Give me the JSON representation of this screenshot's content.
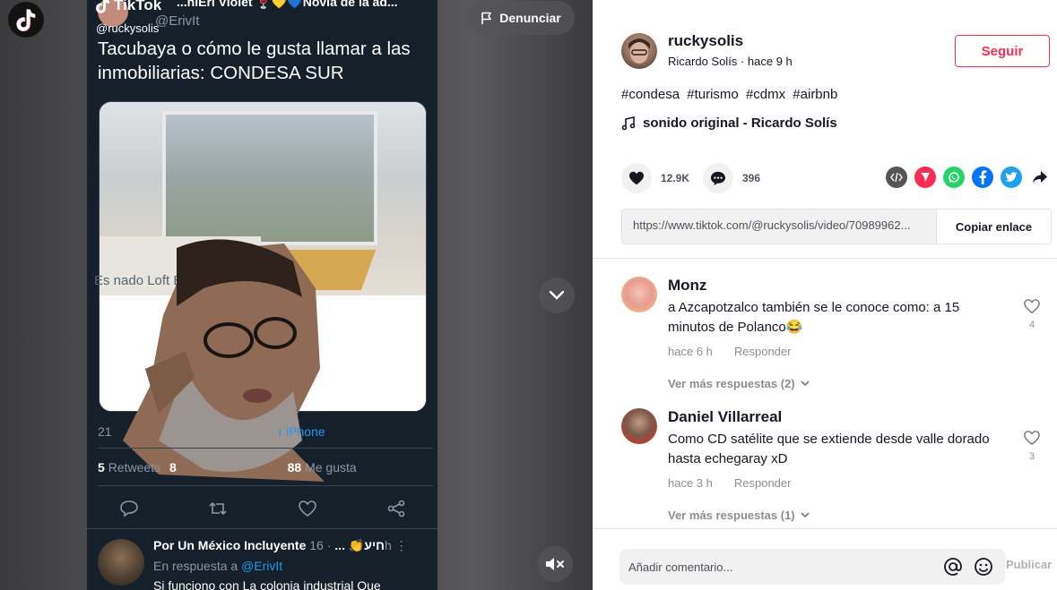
{
  "video": {
    "report_label": "Denunciar",
    "watermark_brand": "TikTok",
    "watermark_user": "@ruckysolis",
    "tweet": {
      "author_name": "...hiEri Violet 🍷💛💙Novia de la ad...",
      "author_handle": "@ErivIt",
      "text": "Tacubaya o cómo le gusta llamar a las inmobiliarias: CONDESA SUR",
      "card_caption": "Es          nado Loft En Condesa Su                566",
      "meta_prefix": "21",
      "meta_source": "r iPhone",
      "retweets_count": "5",
      "retweets_label": "Retweets",
      "quotes_count": "8",
      "likes_count": "88",
      "likes_label": "Me gusta"
    },
    "reply": {
      "author_name": "Por Un México Incluyente חיע👏 ...",
      "time": "· 16h",
      "in_reply_prefix": "En respuesta a",
      "in_reply_handle": "@ErivIt",
      "text": "Si funciono con La colonia industrial Que"
    }
  },
  "author": {
    "username": "ruckysolis",
    "display_name": "Ricardo Solís",
    "time_ago": "hace 9 h",
    "follow_label": "Seguir"
  },
  "description": {
    "hashtags": [
      "#condesa",
      "#turismo",
      "#cdmx",
      "#airbnb"
    ],
    "music": "sonido original - Ricardo Solís"
  },
  "stats": {
    "likes": "12.9K",
    "comments": "396"
  },
  "share": {
    "icons": [
      "embed-icon",
      "send-icon",
      "whatsapp-icon",
      "facebook-icon",
      "twitter-icon",
      "share-arrow-icon"
    ]
  },
  "link": {
    "url": "https://www.tiktok.com/@ruckysolis/video/70989962...",
    "copy_label": "Copiar enlace"
  },
  "comments": [
    {
      "name": "Monz",
      "text": "a Azcapotzalco también se le conoce como: a 15 minutos de Polanco😂",
      "time": "hace 6 h",
      "reply_label": "Responder",
      "likes": "4",
      "more_replies": "Ver más respuestas (2)"
    },
    {
      "name": "Daniel Villarreal",
      "text": "Como CD satélite que se extiende desde valle dorado hasta echegaray xD",
      "time": "hace 3 h",
      "reply_label": "Responder",
      "likes": "3",
      "more_replies": "Ver más respuestas (1)"
    }
  ],
  "composer": {
    "placeholder": "Añadir comentario...",
    "publish_label": "Publicar"
  },
  "colors": {
    "brand_red": "#fe2c55",
    "twitter_bg": "#15202b",
    "twitter_blue": "#1d9bf0"
  }
}
